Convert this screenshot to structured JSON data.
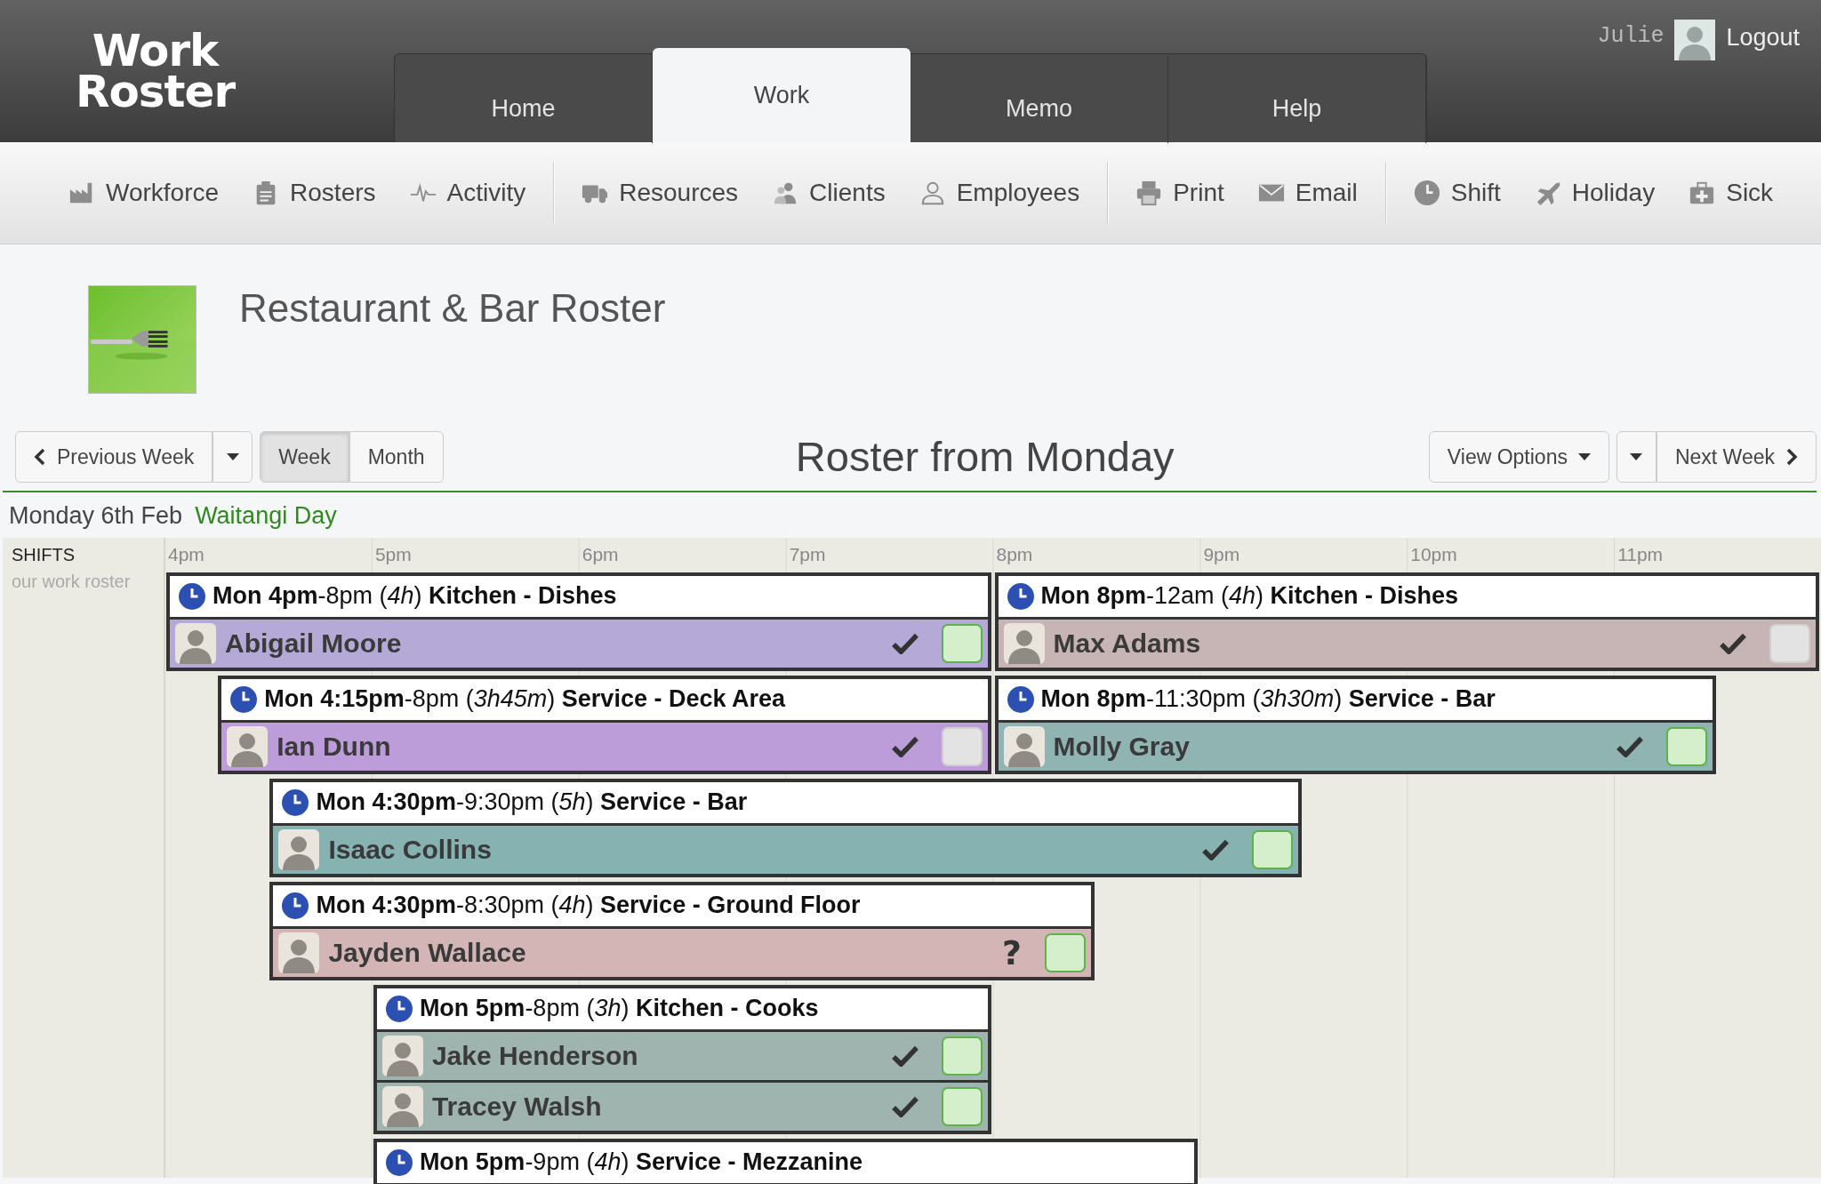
{
  "header": {
    "logo": [
      "Work",
      "Roster"
    ],
    "tabs": [
      {
        "label": "Home",
        "selected": false
      },
      {
        "label": "Work",
        "selected": true
      },
      {
        "label": "Memo",
        "selected": false
      },
      {
        "label": "Help",
        "selected": false
      }
    ],
    "user": {
      "name": "Julie",
      "logout": "Logout"
    }
  },
  "toolbar": [
    [
      {
        "label": "Workforce",
        "kind": "factory"
      },
      {
        "label": "Rosters",
        "kind": "clipboard"
      },
      {
        "label": "Activity",
        "kind": "pulse"
      }
    ],
    [
      {
        "label": "Resources",
        "kind": "truck"
      },
      {
        "label": "Clients",
        "kind": "people"
      },
      {
        "label": "Employees",
        "kind": "person"
      }
    ],
    [
      {
        "label": "Print",
        "kind": "printer"
      },
      {
        "label": "Email",
        "kind": "envelope"
      }
    ],
    [
      {
        "label": "Shift",
        "kind": "clock"
      },
      {
        "label": "Holiday",
        "kind": "plane"
      },
      {
        "label": "Sick",
        "kind": "medkit"
      }
    ]
  ],
  "roster": {
    "title": "Restaurant & Bar Roster"
  },
  "nav": {
    "previous": "Previous Week",
    "views": [
      {
        "label": "Week",
        "selected": true
      },
      {
        "label": "Month",
        "selected": false
      }
    ],
    "heading": "Roster from Monday",
    "view_options": "View Options",
    "next": "Next Week"
  },
  "day": {
    "date": "Monday 6th Feb",
    "holiday": "Waitangi Day"
  },
  "timeline": {
    "side_title": "SHIFTS",
    "side_subtitle": "our work roster",
    "hours": [
      "4pm",
      "5pm",
      "6pm",
      "7pm",
      "8pm",
      "9pm",
      "10pm",
      "11pm"
    ],
    "rows": [
      {
        "shifts": [
          {
            "title": "**Mon 4pm**-8pm (*4h*) **Kitchen - Dishes**",
            "people": [
              {
                "name": "Abigail Moore",
                "color": "#b5a9d8",
                "confirmed": true,
                "acknowledged": true
              }
            ]
          },
          {
            "title": "**Mon 8pm**-12am (*4h*) **Kitchen - Dishes**",
            "people": [
              {
                "name": "Max Adams",
                "color": "#c7b4b4",
                "confirmed": true,
                "acknowledged": false
              }
            ]
          }
        ]
      },
      {
        "shifts": [
          {
            "title": "**Mon 4:15pm**-8pm (*3h45m*) **Service - Deck Area**",
            "people": [
              {
                "name": "Ian Dunn",
                "color": "#bd9dd9",
                "confirmed": true,
                "acknowledged": false
              }
            ]
          },
          {
            "title": "**Mon 8pm**-11:30pm (*3h30m*) **Service - Bar**",
            "people": [
              {
                "name": "Molly Gray",
                "color": "#8fb4b2",
                "confirmed": true,
                "acknowledged": true
              }
            ]
          }
        ]
      },
      {
        "shifts": [
          {
            "title": "**Mon 4:30pm**-9:30pm (*5h*) **Service - Bar**",
            "people": [
              {
                "name": "Isaac Collins",
                "color": "#86b3b1",
                "confirmed": true,
                "acknowledged": true
              }
            ]
          }
        ]
      },
      {
        "shifts": [
          {
            "title": "**Mon 4:30pm**-8:30pm (*4h*) **Service - Ground Floor**",
            "people": [
              {
                "name": "Jayden Wallace",
                "color": "#d4b5b5",
                "confirmed": false,
                "query": "?",
                "acknowledged": true
              }
            ]
          }
        ]
      },
      {
        "shifts": [
          {
            "title": "**Mon 5pm**-8pm (*3h*) **Kitchen - Cooks**",
            "people": [
              {
                "name": "Jake Henderson",
                "color": "#9fb4ae",
                "confirmed": true,
                "acknowledged": true
              },
              {
                "name": "Tracey Walsh",
                "color": "#9fb4ae",
                "confirmed": true,
                "acknowledged": true
              }
            ]
          }
        ]
      },
      {
        "shifts": [
          {
            "title": "**Mon 5pm**-9pm (*4h*) **Service - Mezzanine**"
          }
        ]
      }
    ]
  }
}
